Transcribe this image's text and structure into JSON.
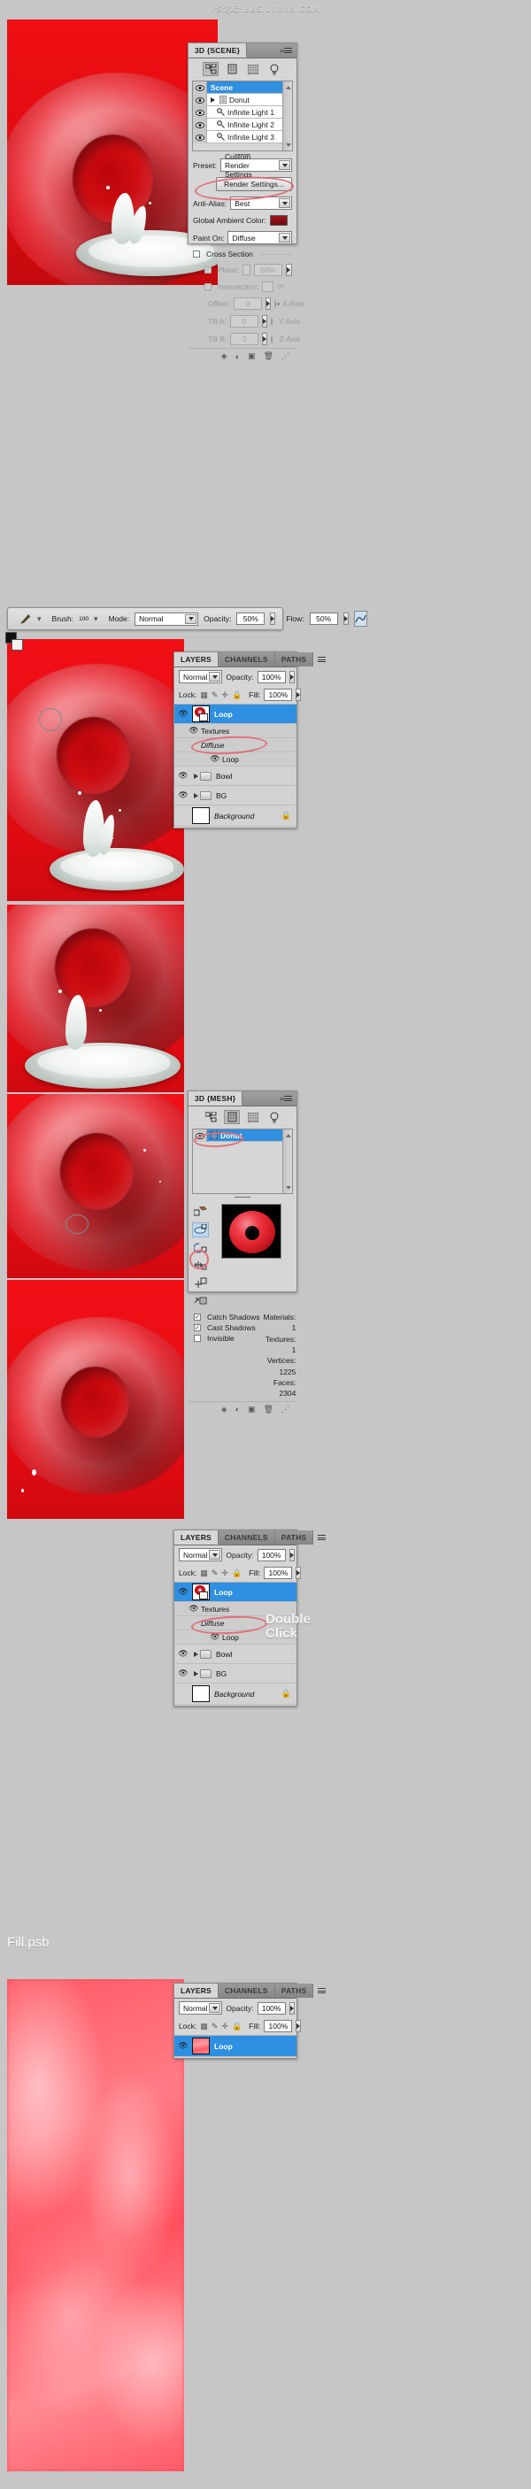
{
  "watermark": "PS论坛:BBS.16XX8.COM",
  "sections": {
    "s1_title": "3D {SCENE}",
    "s5_filename": "Fill.psb"
  },
  "panel_3d_scene": {
    "tab_label": "3D {SCENE}",
    "icons": [
      "scene-icon",
      "mesh-icon",
      "materials-icon",
      "lights-icon"
    ],
    "tree": [
      {
        "label": "Scene",
        "selected": true,
        "has_disclosure": false,
        "icon": ""
      },
      {
        "label": "Donut",
        "selected": false,
        "has_disclosure": true,
        "icon": "mesh-icon"
      },
      {
        "label": "Infinite Light 1",
        "selected": false,
        "has_disclosure": false,
        "icon": "light-icon"
      },
      {
        "label": "Infinite Light 2",
        "selected": false,
        "has_disclosure": false,
        "icon": "light-icon"
      },
      {
        "label": "Infinite Light 3",
        "selected": false,
        "has_disclosure": false,
        "icon": "light-icon"
      }
    ],
    "preset_label": "Preset:",
    "preset_value": "Custom Render Settings",
    "render_settings_button": "Render Settings...",
    "anti_alias_label": "Anti-Alias:",
    "anti_alias_value": "Best",
    "global_ambient_label": "Global Ambient Color:",
    "global_ambient_color": "#8e1014",
    "paint_on_label": "Paint On:",
    "paint_on_value": "Diffuse",
    "cross_section_label": "Cross Section",
    "cross_section_checked": false,
    "plane_label": "Plane:",
    "plane_value": "50%",
    "intersection_label": "Intersection:",
    "offset_label": "Offset:",
    "offset_value": "0",
    "tilt_a_label": "Tilt A:",
    "tilt_a_value": "0",
    "tilt_b_label": "Tilt B:",
    "tilt_b_value": "0",
    "axes": [
      "X-Axis",
      "Y-Axis",
      "Z-Axis"
    ]
  },
  "brush_optionbar": {
    "tool_icon": "brush-icon",
    "brush_label": "Brush:",
    "brush_size": "100",
    "mode_label": "Mode:",
    "mode_value": "Normal",
    "opacity_label": "Opacity:",
    "opacity_value": "50%",
    "flow_label": "Flow:",
    "flow_value": "50%",
    "airbrush_icon": "airbrush-icon"
  },
  "layers_panel_a": {
    "tabs": [
      "LAYERS",
      "CHANNELS",
      "PATHS"
    ],
    "active_tab": "LAYERS",
    "blend_mode": "Normal",
    "opacity_label": "Opacity:",
    "opacity_value": "100%",
    "lock_label": "Lock:",
    "fill_label": "Fill:",
    "fill_value": "100%",
    "rows": [
      {
        "name": "Loop",
        "type": "3d-layer",
        "selected": true,
        "indent": 0
      },
      {
        "name": "Textures",
        "type": "group",
        "selected": false,
        "indent": 1
      },
      {
        "name": "Diffuse",
        "type": "label",
        "selected": false,
        "indent": 2
      },
      {
        "name": "Loop",
        "type": "texture",
        "selected": false,
        "indent": 3
      },
      {
        "name": "Bowl",
        "type": "folder",
        "selected": false,
        "indent": 0
      },
      {
        "name": "BG",
        "type": "folder",
        "selected": false,
        "indent": 0
      },
      {
        "name": "Background",
        "type": "locked",
        "selected": false,
        "indent": 0
      }
    ]
  },
  "panel_3d_mesh": {
    "tab_label": "3D {MESH}",
    "tree": [
      {
        "label": "Donut",
        "selected": true
      }
    ],
    "tools": [
      "rotate-mesh-icon",
      "roll-mesh-icon",
      "pan-mesh-icon",
      "slide-mesh-icon",
      "scale-mesh-icon"
    ],
    "catch_shadows_label": "Catch Shadows",
    "catch_shadows_checked": true,
    "cast_shadows_label": "Cast Shadows",
    "cast_shadows_checked": true,
    "invisible_label": "Invisible",
    "invisible_checked": false,
    "stats": [
      "Materials: 1",
      "Textures: 1",
      "Vertices: 1225",
      "Faces: 2304"
    ]
  },
  "layers_panel_b": {
    "tabs": [
      "LAYERS",
      "CHANNELS",
      "PATHS"
    ],
    "active_tab": "LAYERS",
    "blend_mode": "Normal",
    "opacity_label": "Opacity:",
    "opacity_value": "100%",
    "lock_label": "Lock:",
    "fill_label": "Fill:",
    "fill_value": "100%",
    "annotation": "Double\nClick",
    "annotation_line1": "Double",
    "annotation_line2": "Click",
    "rows": [
      {
        "name": "Loop",
        "type": "3d-layer",
        "selected": true,
        "indent": 0
      },
      {
        "name": "Textures",
        "type": "group",
        "selected": false,
        "indent": 1
      },
      {
        "name": "Diffuse",
        "type": "label",
        "selected": false,
        "indent": 2
      },
      {
        "name": "Loop",
        "type": "texture",
        "selected": false,
        "indent": 3
      },
      {
        "name": "Bowl",
        "type": "folder",
        "selected": false,
        "indent": 0
      },
      {
        "name": "BG",
        "type": "folder",
        "selected": false,
        "indent": 0
      },
      {
        "name": "Background",
        "type": "locked",
        "selected": false,
        "indent": 0
      }
    ]
  },
  "layers_panel_c": {
    "tabs": [
      "LAYERS",
      "CHANNELS",
      "PATHS"
    ],
    "active_tab": "LAYERS",
    "blend_mode": "Normal",
    "opacity_label": "Opacity:",
    "opacity_value": "100%",
    "lock_label": "Lock:",
    "fill_label": "Fill:",
    "fill_value": "100%",
    "rows": [
      {
        "name": "Loop",
        "type": "texture-layer",
        "selected": true,
        "indent": 0
      }
    ]
  },
  "colors": {
    "accent_selection": "#2f8fe0",
    "panel_bg": "#d6d6d6",
    "canvas_red": "#e8121a",
    "annotation_red": "#e06a72",
    "ambient_swatch": "#8e1014"
  }
}
